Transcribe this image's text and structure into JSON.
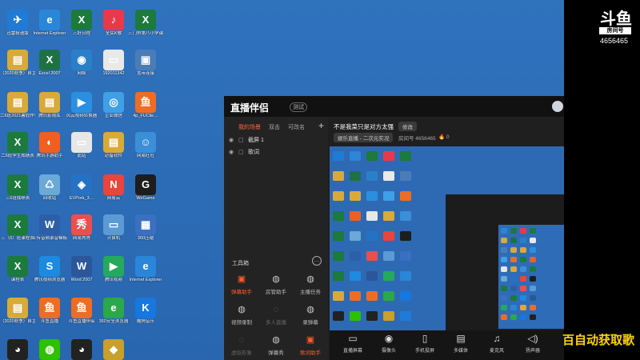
{
  "desktop_icons": [
    {
      "label": "迅雷极速版",
      "icon": "thunder-bird-icon",
      "color": "#1f7bd6",
      "glyph": "✈"
    },
    {
      "label": "Internet Explorer",
      "icon": "ie-icon",
      "color": "#2a86d8",
      "glyph": "e"
    },
    {
      "label": "三好日程",
      "icon": "excel-doc-icon",
      "color": "#1b7a3c",
      "glyph": "X"
    },
    {
      "label": "全民K歌",
      "icon": "kge-icon",
      "color": "#e8394b",
      "glyph": "♪"
    },
    {
      "label": "三门市第八小学课外学习",
      "icon": "excel-doc-icon",
      "color": "#1b7a3c",
      "glyph": "X"
    },
    {
      "label": "（2020秋季）自主与互",
      "icon": "folder-icon",
      "color": "#d9a93a",
      "glyph": "▤"
    },
    {
      "label": "Excel 2007",
      "icon": "excel-icon",
      "color": "#1e7145",
      "glyph": "X"
    },
    {
      "label": "网络",
      "icon": "network-icon",
      "color": "#2a7fc9",
      "glyph": "◉"
    },
    {
      "label": "192011342",
      "icon": "blank-doc-icon",
      "color": "#e9e9e9",
      "glyph": "▭"
    },
    {
      "label": "宽带连接",
      "icon": "broadband-icon",
      "color": "#4a7db8",
      "glyph": "▣"
    },
    {
      "label": "二6班2021暑假作业",
      "icon": "folder-icon",
      "color": "#d9a93a",
      "glyph": "▤"
    },
    {
      "label": "腾讯影视库",
      "icon": "folder-icon",
      "color": "#d9a93a",
      "glyph": "▤"
    },
    {
      "label": "风云视频转换器",
      "icon": "video-convert-icon",
      "color": "#2b8fe0",
      "glyph": "▶"
    },
    {
      "label": "企业微信",
      "icon": "wecom-icon",
      "color": "#3fa0e8",
      "glyph": "◎"
    },
    {
      "label": "4p_FUClie…",
      "icon": "douyu-icon",
      "color": "#ee6d25",
      "glyph": "鱼"
    },
    {
      "label": "二6班学生成绩表",
      "icon": "excel-doc-icon",
      "color": "#1b7a3c",
      "glyph": "X"
    },
    {
      "label": "腾讯手游助手",
      "icon": "game-assistant-icon",
      "color": "#ef5f22",
      "glyph": "◐"
    },
    {
      "label": "此站",
      "icon": "doc-icon",
      "color": "#e7e7e7",
      "glyph": "▭"
    },
    {
      "label": "必备软件",
      "icon": "folder-icon",
      "color": "#d9a93a",
      "glyph": "▤"
    },
    {
      "label": "网易旺旺",
      "icon": "chat-icon",
      "color": "#3a8fd8",
      "glyph": "☺"
    },
    {
      "label": "三6班成绩表",
      "icon": "excel-doc-icon",
      "color": "#1b7a3c",
      "glyph": "X"
    },
    {
      "label": "回收站",
      "icon": "recycle-bin-icon",
      "color": "#6aa9d8",
      "glyph": "♺"
    },
    {
      "label": "EVPork_3…",
      "icon": "ev-icon",
      "color": "#2572c4",
      "glyph": "◈"
    },
    {
      "label": "网易云",
      "icon": "netease-icon",
      "color": "#e8453c",
      "glyph": "N"
    },
    {
      "label": "WeGame",
      "icon": "wegame-icon",
      "color": "#1d1d1d",
      "glyph": "G"
    },
    {
      "label": "三（6）班课程表",
      "icon": "excel-doc-icon",
      "color": "#1b7a3c",
      "glyph": "X"
    },
    {
      "label": "上传音频录音模板",
      "icon": "word-doc-icon",
      "color": "#2d5fa8",
      "glyph": "W"
    },
    {
      "label": "网易秀秀",
      "icon": "xiuxiu-icon",
      "color": "#ea4f4f",
      "glyph": "秀"
    },
    {
      "label": "计算机",
      "icon": "computer-icon",
      "color": "#5b9bd5",
      "glyph": "▭"
    },
    {
      "label": "360压缩",
      "icon": "zip-icon",
      "color": "#3a6fc2",
      "glyph": "▦"
    },
    {
      "label": "课程表",
      "icon": "excel-doc-icon",
      "color": "#1b7a3c",
      "glyph": "X"
    },
    {
      "label": "腾讯视频浏览器",
      "icon": "browser-s-icon",
      "color": "#1d8ae0",
      "glyph": "S"
    },
    {
      "label": "Word 2007",
      "icon": "word-icon",
      "color": "#2b579a",
      "glyph": "W"
    },
    {
      "label": "腾讯视频",
      "icon": "tencent-video-icon",
      "color": "#24a95d",
      "glyph": "▶"
    },
    {
      "label": "Internet Explorer",
      "icon": "ie-icon",
      "color": "#2a86d8",
      "glyph": "e"
    },
    {
      "label": "（2020秋季）自主与互",
      "icon": "folder-icon",
      "color": "#d9a93a",
      "glyph": "▤"
    },
    {
      "label": "斗鱼直播",
      "icon": "douyu-icon",
      "color": "#ee6d25",
      "glyph": "鱼"
    },
    {
      "label": "斗鱼直播伴侣",
      "icon": "douyu-icon",
      "color": "#ee6d25",
      "glyph": "鱼"
    },
    {
      "label": "360安全浏览器",
      "icon": "360-browser-icon",
      "color": "#2aa84a",
      "glyph": "e"
    },
    {
      "label": "酷狗音乐",
      "icon": "kugou-icon",
      "color": "#1677e0",
      "glyph": "K"
    },
    {
      "label": "",
      "icon": "qq-icon",
      "color": "#222222",
      "glyph": "◕"
    },
    {
      "label": "",
      "icon": "wechat-icon",
      "color": "#2dc100",
      "glyph": "◍"
    },
    {
      "label": "",
      "icon": "qq-icon",
      "color": "#222222",
      "glyph": "◕"
    },
    {
      "label": "",
      "icon": "game-icon",
      "color": "#c8a02a",
      "glyph": "◆"
    }
  ],
  "overlay": {
    "logo_text": "斗鱼",
    "logo_sub": "房间号",
    "room_number": "4656465",
    "scroll_text": "百自动获取歌"
  },
  "obs": {
    "brand": "直播伴侣",
    "version": "测试",
    "tabs": [
      "我的场景",
      "双击",
      "可改名"
    ],
    "sources": [
      "截屏 1",
      "歌词"
    ],
    "tools_title": "工具箱",
    "tools": [
      {
        "label": "弹幕助手",
        "icon": "danmaku-icon",
        "state": "hot"
      },
      {
        "label": "房管助手",
        "icon": "admin-icon",
        "state": "normal"
      },
      {
        "label": "主播任务",
        "icon": "task-icon",
        "state": "normal"
      },
      {
        "label": "视频录制",
        "icon": "record-icon",
        "state": "normal"
      },
      {
        "label": "多人直播",
        "icon": "multi-live-icon",
        "state": "dim"
      },
      {
        "label": "录弹幕",
        "icon": "danmaku-record-icon",
        "state": "normal"
      },
      {
        "label": "虚拟形象",
        "icon": "avatar-icon",
        "state": "dim"
      },
      {
        "label": "弹幕秀",
        "icon": "danmaku-show-icon",
        "state": "normal"
      },
      {
        "label": "歌词助手",
        "icon": "lyrics-icon",
        "state": "hot"
      }
    ],
    "room_title": "不是我菜只是对方太强",
    "edit_label": "修改",
    "category": "娱乐直播 - 二次元实况",
    "room_id": "房间号 4656465",
    "hot_count": "0",
    "bottom_tools": [
      {
        "label": "直播屏幕",
        "icon": "screen-icon"
      },
      {
        "label": "摄像头",
        "icon": "camera-icon"
      },
      {
        "label": "手机投屏",
        "icon": "phone-cast-icon"
      },
      {
        "label": "多媒体",
        "icon": "media-icon"
      },
      {
        "label": "麦克风",
        "icon": "mic-icon"
      },
      {
        "label": "扬声器",
        "icon": "speaker-icon"
      }
    ]
  }
}
